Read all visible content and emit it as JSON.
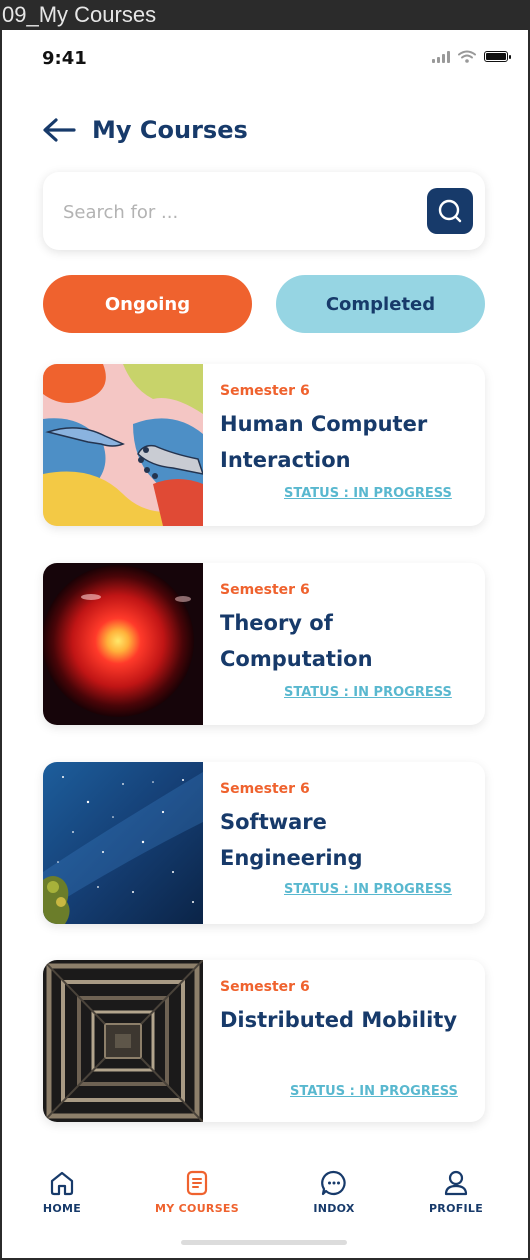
{
  "frame": {
    "title": "09_My Courses"
  },
  "status_bar": {
    "time": "9:41"
  },
  "header": {
    "title": "My Courses"
  },
  "search": {
    "placeholder": "Search for ..."
  },
  "tabs": [
    {
      "label": "Ongoing",
      "active": true
    },
    {
      "label": "Completed",
      "active": false
    }
  ],
  "courses": [
    {
      "semester": "Semester 6",
      "title": "Human Computer Interaction",
      "status": "STATUS : IN PROGRESS"
    },
    {
      "semester": "Semester 6",
      "title": "Theory of Computation",
      "status": "STATUS : IN PROGRESS"
    },
    {
      "semester": "Semester 6",
      "title": "Software Engineering",
      "status": "STATUS : IN PROGRESS"
    },
    {
      "semester": "Semester 6",
      "title": "Distributed Mobility",
      "status": "STATUS : IN PROGRESS"
    }
  ],
  "bottom_nav": [
    {
      "label": "HOME",
      "icon": "home-icon"
    },
    {
      "label": "MY COURSES",
      "icon": "document-icon",
      "active": true
    },
    {
      "label": "INDOX",
      "icon": "chat-icon"
    },
    {
      "label": "PROFILE",
      "icon": "user-icon"
    }
  ],
  "colors": {
    "primary": "#173a6a",
    "accent": "#ef622e",
    "secondary": "#96d5e3",
    "status": "#59b8cf"
  }
}
